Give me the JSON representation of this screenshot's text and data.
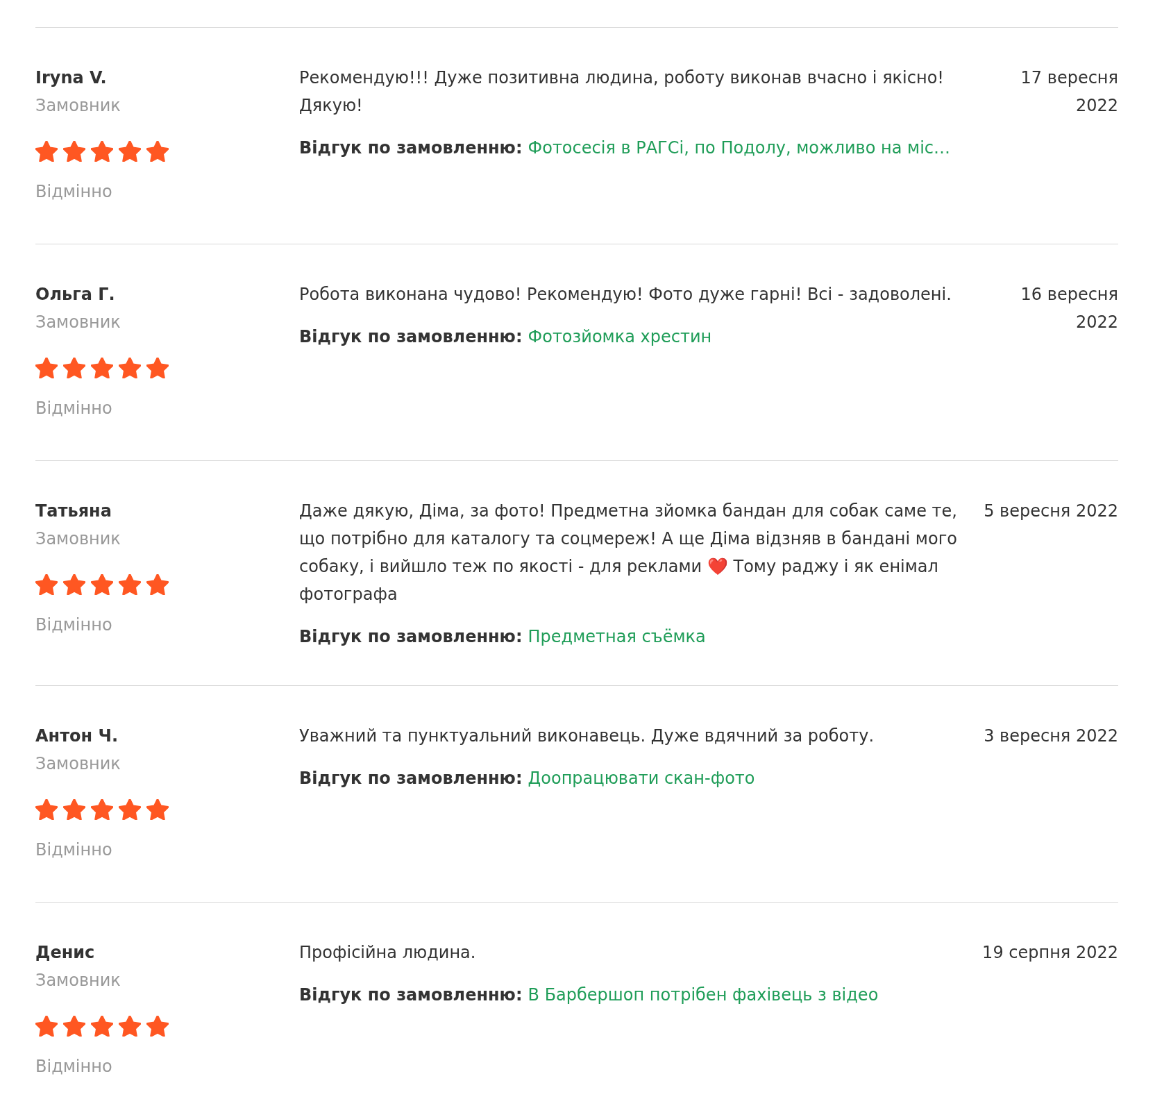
{
  "reviews": [
    {
      "author": "Iryna V.",
      "role": "Замовник",
      "stars": 5,
      "rating": "Відмінно",
      "text": "Рекомендую!!! Дуже позитивна людина, роботу виконав вчасно і якісно! Дякую!",
      "order_label": "Відгук по замовленню:",
      "order_title": "Фотосесія в РАГСі, по Подолу, можливо на міс…",
      "date": "17 вересня 2022"
    },
    {
      "author": "Ольга Г.",
      "role": "Замовник",
      "stars": 5,
      "rating": "Відмінно",
      "text": "Робота виконана чудово! Рекомендую! Фото дуже гарні! Всі - задоволені.",
      "order_label": "Відгук по замовленню:",
      "order_title": "Фотозйомка хрестин",
      "date": "16 вересня 2022"
    },
    {
      "author": "Татьяна",
      "role": "Замовник",
      "stars": 5,
      "rating": "Відмінно",
      "text": "Даже дякую, Діма, за фото! Предметна зйомка бандан для собак саме те, що потрібно для каталогу та соцмереж! А ще Діма відзняв в бандані мого собаку, і вийшло теж по якості - для реклами ❤️ Тому раджу і як енімал фотографа",
      "order_label": "Відгук по замовленню:",
      "order_title": "Предметная съёмка",
      "date": "5 вересня 2022"
    },
    {
      "author": "Антон Ч.",
      "role": "Замовник",
      "stars": 5,
      "rating": "Відмінно",
      "text": "Уважний та пунктуальний виконавець. Дуже вдячний за роботу.",
      "order_label": "Відгук по замовленню:",
      "order_title": "Доопрацювати скан-фото",
      "date": "3 вересня 2022"
    },
    {
      "author": "Денис",
      "role": "Замовник",
      "stars": 5,
      "rating": "Відмінно",
      "text": "Профісійна людина.",
      "order_label": "Відгук по замовленню:",
      "order_title": "В Барбершоп потрібен фахівець з відео",
      "date": "19 серпня 2022"
    }
  ]
}
